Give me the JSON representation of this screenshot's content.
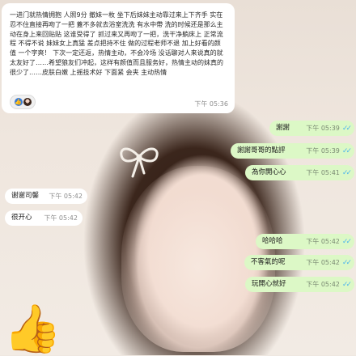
{
  "messages": {
    "top": {
      "text": "一进门就热情拥抱 人照9分 撤妹一枚 坐下后妹妹主动靠过来上下齐手 实在忍不住直接再吻了一把 蓋不多就去浴室洗洗 有水中帶 洗的时候还是那么主动在身上来回贴贴 这谁受得了 抓过来又再吻了一把，洗干净躺床上 正常流程 不得不说 妹妹女上真猛 差点把持不住 做的过程老师不退 加上好看的颜值 一个字爽！ 下次一定还返，热情主动，不会冷场 没话聊对人来说真的就太友好了……希望狼友们冲起，这样有颜值而且服务好，热情主动的妹真的很少了……皮肤白嫩 上摇技术好 下面紧 会夹 主动热情",
      "time": "下午 05:36"
    },
    "right": [
      {
        "text": "謝謝",
        "time": "下午 05:39"
      },
      {
        "text": "謝謝哥哥的點評",
        "time": "下午 05:39"
      },
      {
        "text": "為你開心心",
        "time": "下午 05:41"
      },
      {
        "text": "哈哈哈",
        "time": "下午 05:42"
      },
      {
        "text": "不客氣的呢",
        "time": "下午 05:42"
      },
      {
        "text": "玩開心就好",
        "time": "下午 05:42"
      }
    ],
    "left": [
      {
        "text": "谢谢司馨",
        "time": "下午 05:42"
      },
      {
        "text": "很开心",
        "time": "下午 05:42"
      }
    ]
  },
  "reaction": {
    "emoji": "👍"
  },
  "sticker": {
    "emoji": "👍"
  },
  "colors": {
    "outgoing_bubble": "#dcf8c6",
    "incoming_bubble": "#ffffff",
    "read_ticks": "#4fb6ec"
  }
}
